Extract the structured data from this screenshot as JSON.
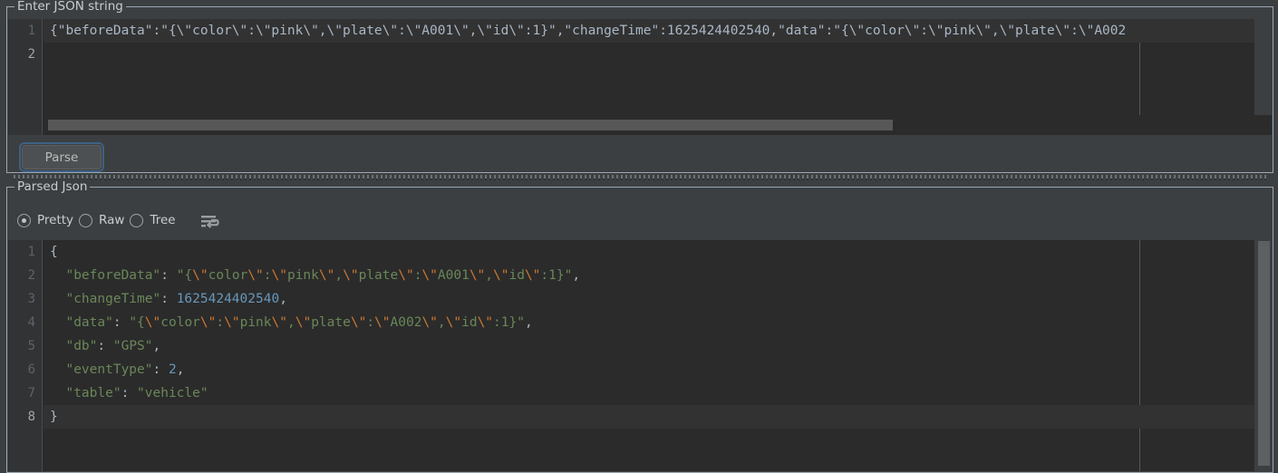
{
  "app": {
    "background": "#3c3f41",
    "editor_background": "#2b2b2b",
    "accent": "#3d6185",
    "token_colors": {
      "string": "#6a8759",
      "escape": "#cc7832",
      "number": "#6897bb",
      "punctuation": "#a9b7c6"
    }
  },
  "input_panel": {
    "title": "Enter JSON string",
    "line_numbers": [
      "1",
      "2"
    ],
    "current_line": 2,
    "lines": [
      "{\"beforeData\":\"{\\\"color\\\":\\\"pink\\\",\\\"plate\\\":\\\"A001\\\",\\\"id\\\":1}\",\"changeTime\":1625424402540,\"data\":\"{\\\"color\\\":\\\"pink\\\",\\\"plate\\\":\\\"A002",
      ""
    ],
    "horizontal_scrollbar": {
      "visible": true
    },
    "parse_button": {
      "label": "Parse",
      "focused": true
    }
  },
  "output_panel": {
    "title": "Parsed Json",
    "view_options": [
      {
        "label": "Pretty",
        "selected": true
      },
      {
        "label": "Raw",
        "selected": false
      },
      {
        "label": "Tree",
        "selected": false
      }
    ],
    "wrap_icon": "soft-wrap-icon",
    "line_numbers": [
      "1",
      "2",
      "3",
      "4",
      "5",
      "6",
      "7",
      "8"
    ],
    "current_line": 8,
    "json_text": "{\n  \"beforeData\": \"{\\\"color\\\":\\\"pink\\\",\\\"plate\\\":\\\"A001\\\",\\\"id\\\":1}\",\n  \"changeTime\": 1625424402540,\n  \"data\": \"{\\\"color\\\":\\\"pink\\\",\\\"plate\\\":\\\"A002\\\",\\\"id\\\":1}\",\n  \"db\": \"GPS\",\n  \"eventType\": 2,\n  \"table\": \"vehicle\"\n}",
    "parsed_values": {
      "beforeData": "{\"color\":\"pink\",\"plate\":\"A001\",\"id\":1}",
      "changeTime": 1625424402540,
      "data": "{\"color\":\"pink\",\"plate\":\"A002\",\"id\":1}",
      "db": "GPS",
      "eventType": 2,
      "table": "vehicle"
    },
    "tokens": {
      "l1": [
        {
          "t": "{",
          "c": "p"
        }
      ],
      "l2": [
        {
          "t": "  ",
          "c": "p"
        },
        {
          "t": "\"beforeData\"",
          "c": "k"
        },
        {
          "t": ":",
          "c": "p"
        },
        {
          "t": " ",
          "c": "p"
        },
        {
          "t": "\"{",
          "c": "s"
        },
        {
          "t": "\\\"",
          "c": "esc"
        },
        {
          "t": "color",
          "c": "s"
        },
        {
          "t": "\\\"",
          "c": "esc"
        },
        {
          "t": ":",
          "c": "s"
        },
        {
          "t": "\\\"",
          "c": "esc"
        },
        {
          "t": "pink",
          "c": "s"
        },
        {
          "t": "\\\"",
          "c": "esc"
        },
        {
          "t": ",",
          "c": "s"
        },
        {
          "t": "\\\"",
          "c": "esc"
        },
        {
          "t": "plate",
          "c": "s"
        },
        {
          "t": "\\\"",
          "c": "esc"
        },
        {
          "t": ":",
          "c": "s"
        },
        {
          "t": "\\\"",
          "c": "esc"
        },
        {
          "t": "A001",
          "c": "s"
        },
        {
          "t": "\\\"",
          "c": "esc"
        },
        {
          "t": ",",
          "c": "s"
        },
        {
          "t": "\\\"",
          "c": "esc"
        },
        {
          "t": "id",
          "c": "s"
        },
        {
          "t": "\\\"",
          "c": "esc"
        },
        {
          "t": ":1}\"",
          "c": "s"
        },
        {
          "t": ",",
          "c": "p"
        }
      ],
      "l3": [
        {
          "t": "  ",
          "c": "p"
        },
        {
          "t": "\"changeTime\"",
          "c": "k"
        },
        {
          "t": ": ",
          "c": "p"
        },
        {
          "t": "1625424402540",
          "c": "n"
        },
        {
          "t": ",",
          "c": "p"
        }
      ],
      "l4": [
        {
          "t": "  ",
          "c": "p"
        },
        {
          "t": "\"data\"",
          "c": "k"
        },
        {
          "t": ": ",
          "c": "p"
        },
        {
          "t": "\"{",
          "c": "s"
        },
        {
          "t": "\\\"",
          "c": "esc"
        },
        {
          "t": "color",
          "c": "s"
        },
        {
          "t": "\\\"",
          "c": "esc"
        },
        {
          "t": ":",
          "c": "s"
        },
        {
          "t": "\\\"",
          "c": "esc"
        },
        {
          "t": "pink",
          "c": "s"
        },
        {
          "t": "\\\"",
          "c": "esc"
        },
        {
          "t": ",",
          "c": "s"
        },
        {
          "t": "\\\"",
          "c": "esc"
        },
        {
          "t": "plate",
          "c": "s"
        },
        {
          "t": "\\\"",
          "c": "esc"
        },
        {
          "t": ":",
          "c": "s"
        },
        {
          "t": "\\\"",
          "c": "esc"
        },
        {
          "t": "A002",
          "c": "s"
        },
        {
          "t": "\\\"",
          "c": "esc"
        },
        {
          "t": ",",
          "c": "s"
        },
        {
          "t": "\\\"",
          "c": "esc"
        },
        {
          "t": "id",
          "c": "s"
        },
        {
          "t": "\\\"",
          "c": "esc"
        },
        {
          "t": ":1}\"",
          "c": "s"
        },
        {
          "t": ",",
          "c": "p"
        }
      ],
      "l5": [
        {
          "t": "  ",
          "c": "p"
        },
        {
          "t": "\"db\"",
          "c": "k"
        },
        {
          "t": ": ",
          "c": "p"
        },
        {
          "t": "\"GPS\"",
          "c": "s"
        },
        {
          "t": ",",
          "c": "p"
        }
      ],
      "l6": [
        {
          "t": "  ",
          "c": "p"
        },
        {
          "t": "\"eventType\"",
          "c": "k"
        },
        {
          "t": ": ",
          "c": "p"
        },
        {
          "t": "2",
          "c": "n"
        },
        {
          "t": ",",
          "c": "p"
        }
      ],
      "l7": [
        {
          "t": "  ",
          "c": "p"
        },
        {
          "t": "\"table\"",
          "c": "k"
        },
        {
          "t": ": ",
          "c": "p"
        },
        {
          "t": "\"vehicle\"",
          "c": "s"
        }
      ],
      "l8": [
        {
          "t": "}",
          "c": "p"
        }
      ]
    }
  }
}
